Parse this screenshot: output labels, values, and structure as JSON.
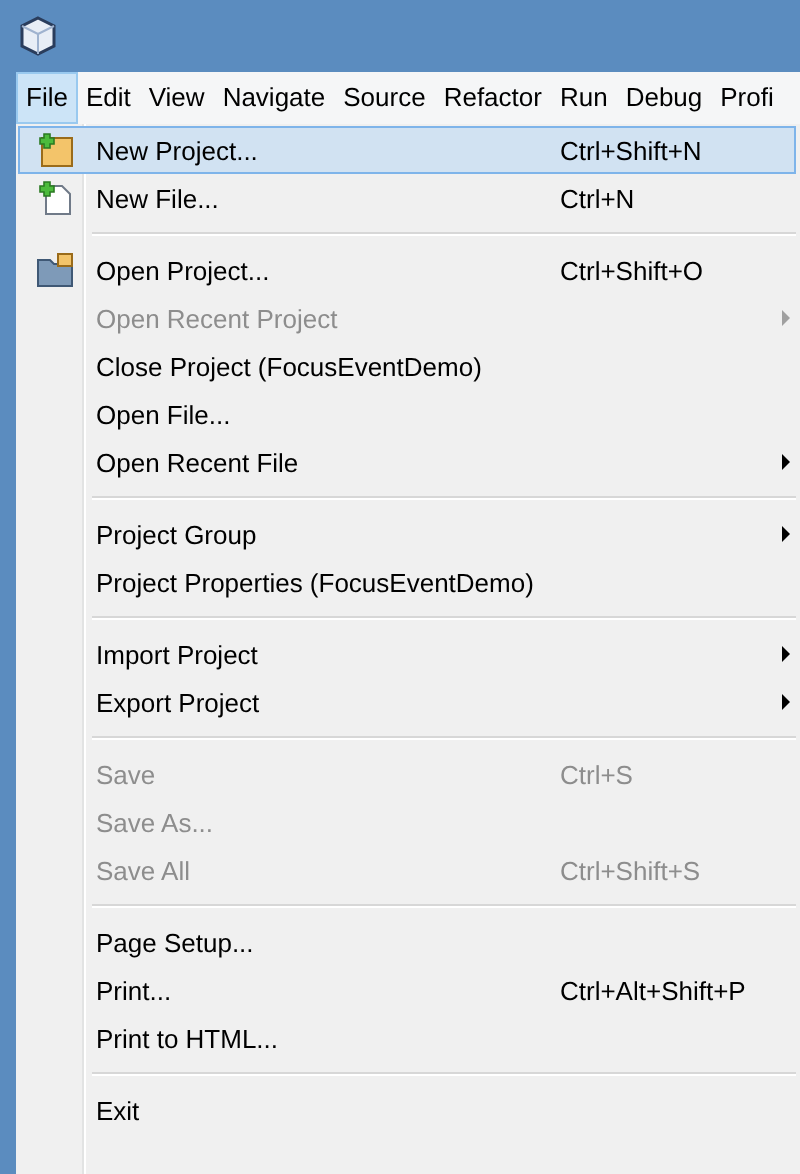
{
  "menubar": [
    {
      "label": "File",
      "selected": true
    },
    {
      "label": "Edit",
      "selected": false
    },
    {
      "label": "View",
      "selected": false
    },
    {
      "label": "Navigate",
      "selected": false
    },
    {
      "label": "Source",
      "selected": false
    },
    {
      "label": "Refactor",
      "selected": false
    },
    {
      "label": "Run",
      "selected": false
    },
    {
      "label": "Debug",
      "selected": false
    },
    {
      "label": "Profi",
      "selected": false
    }
  ],
  "menu": [
    {
      "kind": "item",
      "label": "New Project...",
      "shortcut": "Ctrl+Shift+N",
      "selected": true,
      "disabled": false,
      "submenu": false
    },
    {
      "kind": "item",
      "label": "New File...",
      "shortcut": "Ctrl+N",
      "selected": false,
      "disabled": false,
      "submenu": false
    },
    {
      "kind": "separator"
    },
    {
      "kind": "item",
      "label": "Open Project...",
      "shortcut": "Ctrl+Shift+O",
      "selected": false,
      "disabled": false,
      "submenu": false
    },
    {
      "kind": "item",
      "label": "Open Recent Project",
      "selected": false,
      "disabled": true,
      "submenu": true
    },
    {
      "kind": "item",
      "label": "Close Project (FocusEventDemo)",
      "selected": false,
      "disabled": false,
      "submenu": false
    },
    {
      "kind": "item",
      "label": "Open File...",
      "selected": false,
      "disabled": false,
      "submenu": false
    },
    {
      "kind": "item",
      "label": "Open Recent File",
      "selected": false,
      "disabled": false,
      "submenu": true
    },
    {
      "kind": "separator"
    },
    {
      "kind": "item",
      "label": "Project Group",
      "selected": false,
      "disabled": false,
      "submenu": true
    },
    {
      "kind": "item",
      "label": "Project Properties (FocusEventDemo)",
      "selected": false,
      "disabled": false,
      "submenu": false
    },
    {
      "kind": "separator"
    },
    {
      "kind": "item",
      "label": "Import Project",
      "selected": false,
      "disabled": false,
      "submenu": true
    },
    {
      "kind": "item",
      "label": "Export Project",
      "selected": false,
      "disabled": false,
      "submenu": true
    },
    {
      "kind": "separator"
    },
    {
      "kind": "item",
      "label": "Save",
      "shortcut": "Ctrl+S",
      "selected": false,
      "disabled": true,
      "submenu": false
    },
    {
      "kind": "item",
      "label": "Save As...",
      "selected": false,
      "disabled": true,
      "submenu": false
    },
    {
      "kind": "item",
      "label": "Save All",
      "shortcut": "Ctrl+Shift+S",
      "selected": false,
      "disabled": true,
      "submenu": false
    },
    {
      "kind": "separator"
    },
    {
      "kind": "item",
      "label": "Page Setup...",
      "selected": false,
      "disabled": false,
      "submenu": false
    },
    {
      "kind": "item",
      "label": "Print...",
      "shortcut": "Ctrl+Alt+Shift+P",
      "selected": false,
      "disabled": false,
      "submenu": false
    },
    {
      "kind": "item",
      "label": "Print to HTML...",
      "selected": false,
      "disabled": false,
      "submenu": false
    },
    {
      "kind": "separator"
    },
    {
      "kind": "item",
      "label": "Exit",
      "selected": false,
      "disabled": false,
      "submenu": false
    }
  ]
}
